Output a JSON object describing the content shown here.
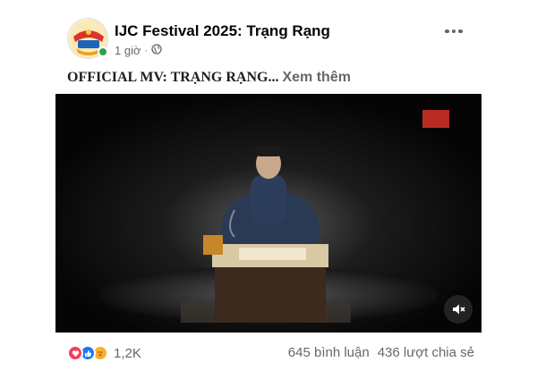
{
  "post": {
    "page_name": "IJC Festival 2025: Trạng Rạng",
    "time": "1 giờ",
    "separator": "·",
    "audience_icon": "globe-icon",
    "caption_title": "OFFICIAL MV: TRẠNG RẠNG...",
    "see_more": "Xem thêm"
  },
  "video": {
    "watermark": "logo",
    "mute_icon": "speaker-muted-icon"
  },
  "footer": {
    "reaction_icons": [
      "love-icon",
      "like-icon",
      "care-icon"
    ],
    "reaction_count": "1,2K",
    "comments": "645 bình luận",
    "shares": "436 lượt chia sẻ"
  },
  "colors": {
    "secondary_text": "#65676b",
    "online": "#31a24c",
    "like_blue": "#1877f2",
    "love_red": "#f33e58"
  }
}
